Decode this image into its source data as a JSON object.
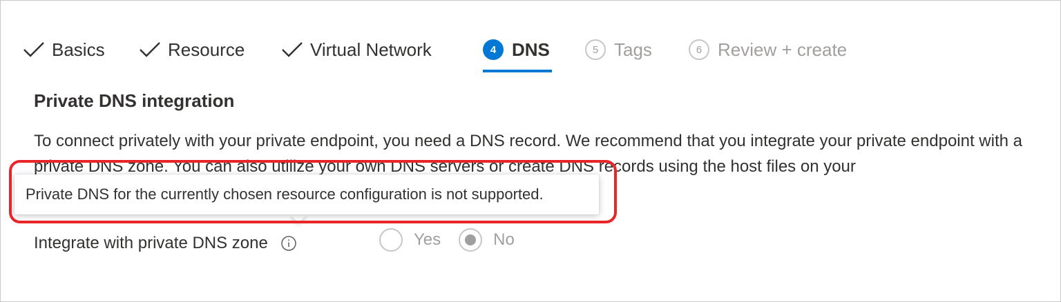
{
  "tabs": [
    {
      "label": "Basics",
      "state": "completed"
    },
    {
      "label": "Resource",
      "state": "completed"
    },
    {
      "label": "Virtual Network",
      "state": "completed"
    },
    {
      "number": "4",
      "label": "DNS",
      "state": "active"
    },
    {
      "number": "5",
      "label": "Tags",
      "state": "disabled"
    },
    {
      "number": "6",
      "label": "Review + create",
      "state": "disabled"
    }
  ],
  "section": {
    "title": "Private DNS integration",
    "description": "To connect privately with your private endpoint, you need a DNS record. We recommend that you integrate your private endpoint with a private DNS zone. You can also utilize your own DNS servers or create DNS records using the host files on your"
  },
  "tooltip": {
    "text": "Private DNS for the currently chosen resource configuration is not supported."
  },
  "integrate_field": {
    "label": "Integrate with private DNS zone",
    "info_icon": "info-icon",
    "options": [
      {
        "label": "Yes",
        "selected": false
      },
      {
        "label": "No",
        "selected": true
      }
    ]
  },
  "colors": {
    "accent": "#0078d4",
    "highlight": "#e8262a",
    "disabled_text": "#a19f9d"
  }
}
